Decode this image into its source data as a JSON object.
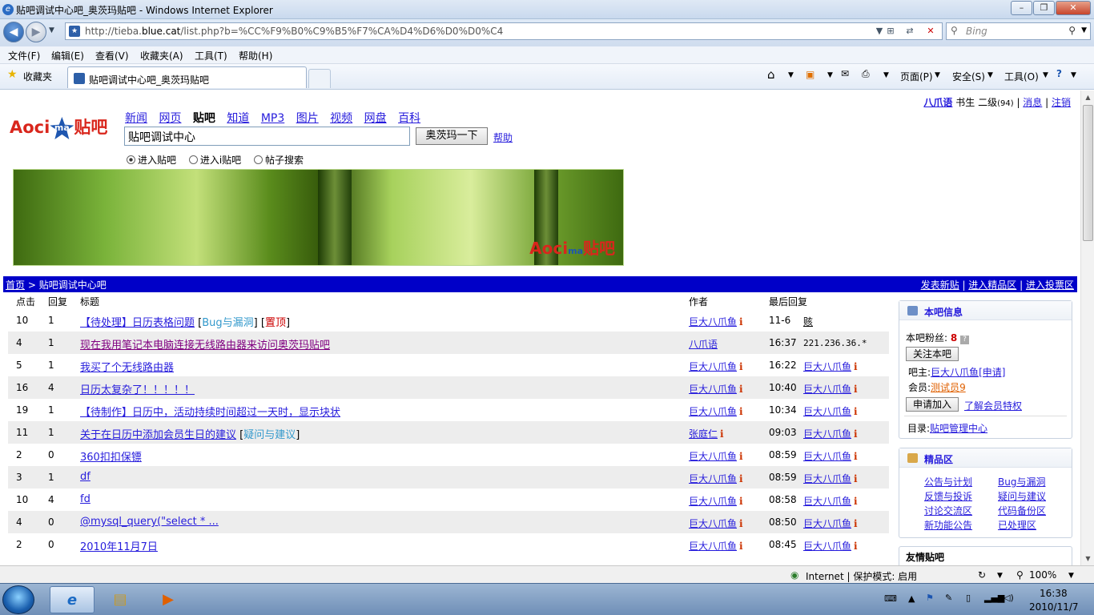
{
  "browser": {
    "window_title": "贴吧调试中心吧_奥茨玛贴吧 - Windows Internet Explorer",
    "url_pre": "http://tieba.",
    "url_host": "blue.cat",
    "url_post": "/list.php?b=%CC%F9%B0%C9%B5%F7%CA%D4%D6%D0%D0%C4",
    "search_placeholder": "Bing",
    "menu": [
      "文件(F)",
      "编辑(E)",
      "查看(V)",
      "收藏夹(A)",
      "工具(T)",
      "帮助(H)"
    ],
    "favorites_label": "收藏夹",
    "tab_title": "贴吧调试中心吧_奥茨玛贴吧",
    "cmd": {
      "page": "页面(P)",
      "safety": "安全(S)",
      "tools": "工具(O)"
    },
    "status": {
      "zone": "Internet | 保护模式: 启用",
      "zoom": "100%"
    }
  },
  "site": {
    "logo_text": "Aoci",
    "logo_badge": "ma",
    "logo_tail": "贴吧",
    "nav": [
      "新闻",
      "网页",
      "贴吧",
      "知道",
      "MP3",
      "图片",
      "视频",
      "网盘",
      "百科"
    ],
    "nav_active": "贴吧",
    "search_value": "贴吧调试中心",
    "search_button": "奥茨玛一下",
    "help": "帮助",
    "radios": [
      "进入贴吧",
      "进入i贴吧",
      "帖子搜索"
    ],
    "user": {
      "name": "八爪语",
      "title": "书生",
      "level": "二级",
      "level_num": "(94)",
      "msg": "消息",
      "logout": "注销"
    }
  },
  "breadcrumb": {
    "home": "首页",
    "sep": ">",
    "current": "贴吧调试中心吧",
    "actions": [
      "发表新贴",
      "进入精品区",
      "进入投票区"
    ]
  },
  "thread_list": {
    "headers": {
      "clicks": "点击",
      "replies": "回复",
      "title": "标题",
      "author": "作者",
      "last": "最后回复"
    },
    "rows": [
      {
        "clicks": "10",
        "replies": "1",
        "title": "【待处理】日历表格问题",
        "tag": "Bug与漏洞",
        "top": "置顶",
        "author": "巨大八爪鱼",
        "author_i": true,
        "time": "11-6",
        "last_user": "赅",
        "last_i": false
      },
      {
        "clicks": "4",
        "replies": "1",
        "title": "现在我用笔记本电脑连接无线路由器来访问奥茨玛贴吧",
        "tag": "",
        "top": "",
        "author": "八爪语",
        "author_i": false,
        "time": "16:37",
        "last_user": "221.236.36.*",
        "last_i": false
      },
      {
        "clicks": "5",
        "replies": "1",
        "title": "我买了个无线路由器",
        "tag": "",
        "top": "",
        "author": "巨大八爪鱼",
        "author_i": true,
        "time": "16:22",
        "last_user": "巨大八爪鱼",
        "last_i": true
      },
      {
        "clicks": "16",
        "replies": "4",
        "title": "日历太复杂了！！！！！",
        "tag": "",
        "top": "",
        "author": "巨大八爪鱼",
        "author_i": true,
        "time": "10:40",
        "last_user": "巨大八爪鱼",
        "last_i": true
      },
      {
        "clicks": "19",
        "replies": "1",
        "title": "【待制作】日历中，活动持续时间超过一天时，显示块状",
        "tag": "",
        "top": "",
        "author": "巨大八爪鱼",
        "author_i": true,
        "time": "10:34",
        "last_user": "巨大八爪鱼",
        "last_i": true
      },
      {
        "clicks": "11",
        "replies": "1",
        "title": "关于在日历中添加会员生日的建议",
        "tag": "疑问与建议",
        "top": "",
        "author": "张庭仁",
        "author_i": true,
        "time": "09:03",
        "last_user": "巨大八爪鱼",
        "last_i": true
      },
      {
        "clicks": "2",
        "replies": "0",
        "title": "360扣扣保镖",
        "tag": "",
        "top": "",
        "author": "巨大八爪鱼",
        "author_i": true,
        "time": "08:59",
        "last_user": "巨大八爪鱼",
        "last_i": true
      },
      {
        "clicks": "3",
        "replies": "1",
        "title": "df",
        "tag": "",
        "top": "",
        "author": "巨大八爪鱼",
        "author_i": true,
        "time": "08:59",
        "last_user": "巨大八爪鱼",
        "last_i": true
      },
      {
        "clicks": "10",
        "replies": "4",
        "title": "fd",
        "tag": "",
        "top": "",
        "author": "巨大八爪鱼",
        "author_i": true,
        "time": "08:58",
        "last_user": "巨大八爪鱼",
        "last_i": true
      },
      {
        "clicks": "4",
        "replies": "0",
        "title": "@mysql_query(\"select * ...",
        "tag": "",
        "top": "",
        "author": "巨大八爪鱼",
        "author_i": true,
        "time": "08:50",
        "last_user": "巨大八爪鱼",
        "last_i": true
      },
      {
        "clicks": "2",
        "replies": "0",
        "title": "2010年11月7日",
        "tag": "",
        "top": "",
        "author": "巨大八爪鱼",
        "author_i": true,
        "time": "08:45",
        "last_user": "巨大八爪鱼",
        "last_i": true
      }
    ]
  },
  "sidebar": {
    "info_title": "本吧信息",
    "fans_label": "本吧粉丝:",
    "fans_count": "8",
    "follow_button": "关注本吧",
    "owner_label": "吧主:",
    "owner_name": "巨大八爪鱼",
    "owner_apply": "[申请]",
    "member_label": "会员:",
    "member_name": "测试员",
    "member_count": "9",
    "join_button": "申请加入",
    "member_privilege": "了解会员特权",
    "dir_label": "目录:",
    "dir_value": "贴吧管理中心",
    "featured_title": "精品区",
    "featured_links": [
      "公告与计划",
      "Bug与漏洞",
      "反馈与投诉",
      "疑问与建议",
      "讨论交流区",
      "代码备份区",
      "新功能公告",
      "已处理区"
    ],
    "friends_title": "友情贴吧"
  },
  "taskbar": {
    "time": "16:38",
    "date": "2010/11/7"
  }
}
